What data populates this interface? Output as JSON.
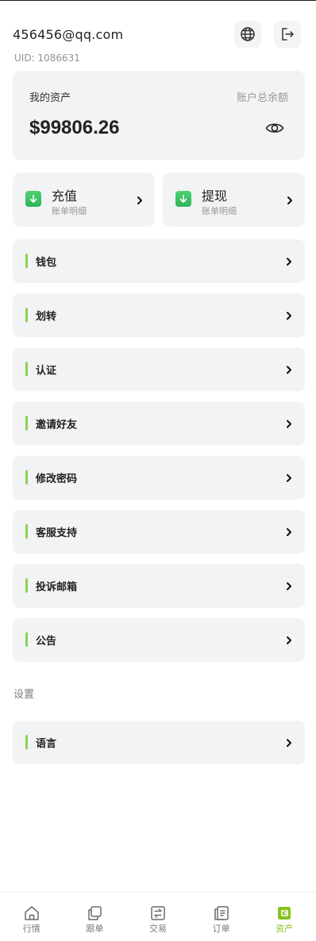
{
  "header": {
    "email": "456456@qq.com",
    "uid": "UID: 1086631",
    "icons": [
      "globe-icon",
      "logout-icon"
    ]
  },
  "asset_card": {
    "title": "我的资产",
    "total_label": "账户总余额",
    "amount": "$99806.26",
    "icon": "eye-icon"
  },
  "quick_actions": [
    {
      "label": "充值",
      "sub": "账单明细",
      "icon": "download-arrow-icon"
    },
    {
      "label": "提现",
      "sub": "账单明细",
      "icon": "download-arrow-icon"
    }
  ],
  "menu": [
    {
      "label": "钱包"
    },
    {
      "label": "划转"
    },
    {
      "label": "认证"
    },
    {
      "label": "邀请好友"
    },
    {
      "label": "修改密码"
    },
    {
      "label": "客服支持"
    },
    {
      "label": "投诉邮箱"
    },
    {
      "label": "公告"
    }
  ],
  "settings": {
    "title": "设置",
    "items": [
      {
        "label": "语言"
      }
    ]
  },
  "tabbar": {
    "active": "资产",
    "active_color": "#86c21e",
    "accent_color": "#8fd14f",
    "tabs": [
      {
        "label": "行情",
        "icon": "home-icon"
      },
      {
        "label": "跟单",
        "icon": "copy-icon"
      },
      {
        "label": "交易",
        "icon": "exchange-icon"
      },
      {
        "label": "订单",
        "icon": "order-icon"
      },
      {
        "label": "资产",
        "icon": "wallet-icon"
      }
    ]
  }
}
